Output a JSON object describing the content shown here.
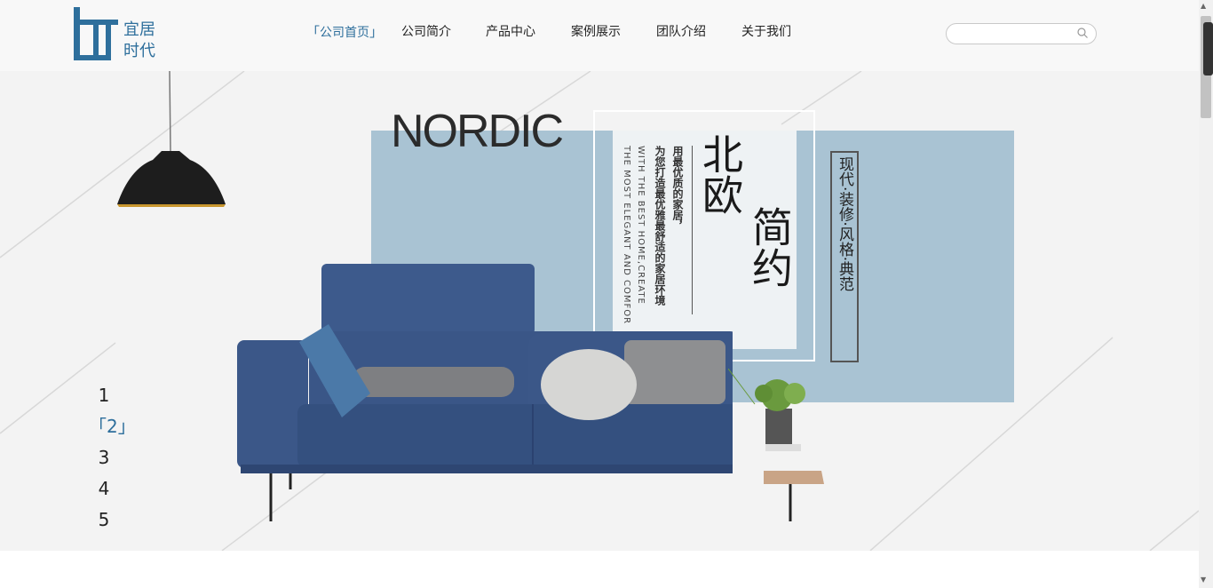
{
  "header": {
    "logo_line1": "宜居",
    "logo_line2": "时代",
    "nav": [
      {
        "label": "公司首页",
        "active": true
      },
      {
        "label": "公司简介",
        "active": false
      },
      {
        "label": "产品中心",
        "active": false
      },
      {
        "label": "案例展示",
        "active": false
      },
      {
        "label": "团队介绍",
        "active": false
      },
      {
        "label": "关于我们",
        "active": false
      }
    ],
    "active_left_bracket": "「",
    "active_right_bracket": "」",
    "search_placeholder": "",
    "search_icon": "search-icon"
  },
  "banner": {
    "title": "NORDIC",
    "english_line1": "WITH THE BEST HOME,CREATE",
    "english_line2": "THE MOST ELEGANT AND COMFOR",
    "cn_line1": "用最优质的家居，",
    "cn_line2": "为您打造最优雅最舒适的家居环境",
    "big_word1": "北欧",
    "big_word2": "简约",
    "style_text": "现代·装修·风格·典范"
  },
  "pager": {
    "items": [
      "1",
      "2",
      "3",
      "4",
      "5"
    ],
    "active_index": 1,
    "active_left": "「",
    "active_right": "」"
  },
  "colors": {
    "accent": "#2e6f9c",
    "panel": "#a9c3d3",
    "sofa": "#3a5687",
    "background": "#f3f3f3"
  }
}
